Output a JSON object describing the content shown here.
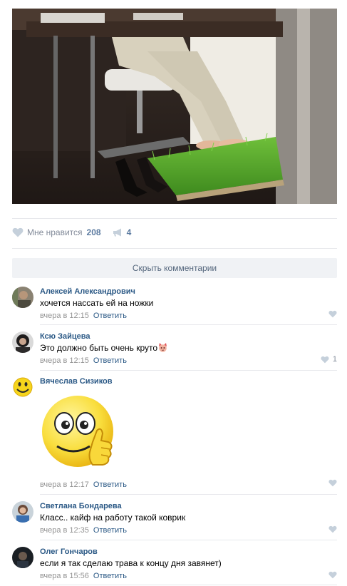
{
  "post": {
    "likes": {
      "label": "Мне нравится",
      "count": "208"
    },
    "shares": {
      "count": "4"
    },
    "hide_comments_label": "Скрыть комментарии"
  },
  "comments": [
    {
      "author": "Алексей Александрович",
      "text": "хочется нассать ей на ножки",
      "time": "вчера в 12:15",
      "reply": "Ответить",
      "likes": ""
    },
    {
      "author": "Ксю Зайцева",
      "text": "Это должно быть очень круто",
      "emoji": "cat-face-emoji",
      "time": "вчера в 12:15",
      "reply": "Ответить",
      "likes": "1"
    },
    {
      "author": "Вячеслав Сизиков",
      "sticker": "thumbs-up-smiley-sticker",
      "time": "вчера в 12:17",
      "reply": "Ответить",
      "likes": ""
    },
    {
      "author": "Светлана Бондарева",
      "text": "Класс.. кайф на работу такой коврик",
      "time": "вчера в 12:35",
      "reply": "Ответить",
      "likes": ""
    },
    {
      "author": "Олег Гончаров",
      "text": "если я так сделаю трава к концу дня завянет)",
      "time": "вчера в 15:56",
      "reply": "Ответить",
      "likes": ""
    }
  ],
  "colors": {
    "link": "#2a5885",
    "muted": "#939393",
    "button_bg": "#f0f2f5",
    "divider": "#e7e8ec"
  }
}
